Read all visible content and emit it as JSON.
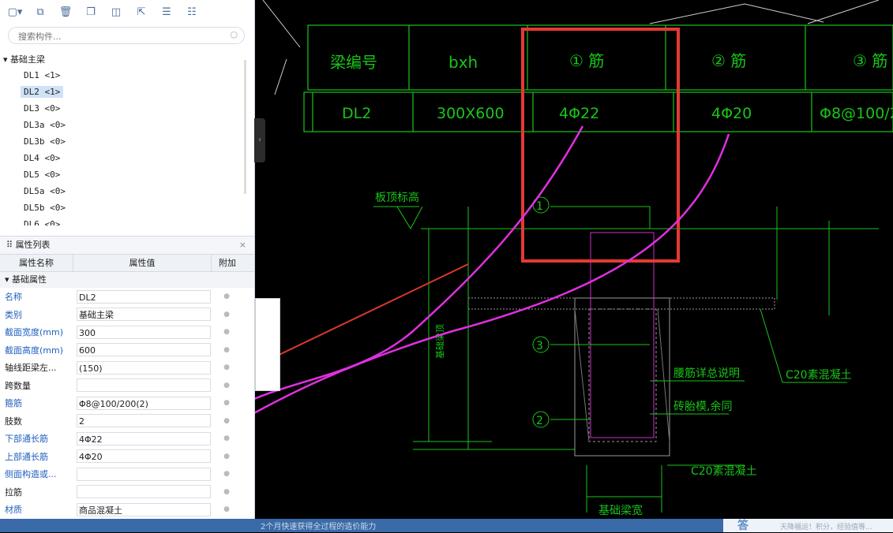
{
  "toolbar": {
    "icons": [
      "new-icon",
      "copy-icon",
      "delete-icon",
      "duplicate-icon",
      "layer-icon",
      "export-icon",
      "list-icon",
      "settings-icon"
    ]
  },
  "search": {
    "placeholder": "搜索构件..."
  },
  "tree": {
    "root": "基础主梁",
    "items": [
      "DL1 <1>",
      "DL2 <1>",
      "DL3 <0>",
      "DL3a <0>",
      "DL3b <0>",
      "DL4 <0>",
      "DL5 <0>",
      "DL5a <0>",
      "DL5b <0>",
      "DL6 <0>"
    ],
    "selected": "DL2 <1>"
  },
  "props": {
    "title": "属性列表",
    "close": "×",
    "col_name": "属性名称",
    "col_value": "属性值",
    "col_extra": "附加",
    "group": "基础属性",
    "rows": [
      {
        "name": "名称",
        "value": "DL2"
      },
      {
        "name": "类别",
        "value": "基础主梁"
      },
      {
        "name": "截面宽度(mm)",
        "value": "300"
      },
      {
        "name": "截面高度(mm)",
        "value": "600"
      },
      {
        "name": "轴线距梁左...",
        "value": "(150)"
      },
      {
        "name": "跨数量",
        "value": ""
      },
      {
        "name": "箍筋",
        "value": "Φ8@100/200(2)"
      },
      {
        "name": "肢数",
        "value": "2"
      },
      {
        "name": "下部通长筋",
        "value": "4Φ22"
      },
      {
        "name": "上部通长筋",
        "value": "4Φ20"
      },
      {
        "name": "侧面构造或...",
        "value": ""
      },
      {
        "name": "拉筋",
        "value": ""
      },
      {
        "name": "材质",
        "value": "商品混凝土"
      }
    ]
  },
  "cad": {
    "headers": [
      "梁编号",
      "bxh",
      "① 筋",
      "② 筋",
      "③ 筋"
    ],
    "row": [
      "DL2",
      "300X600",
      "4Φ22",
      "4Φ20",
      "Φ8@100/2"
    ],
    "labels": {
      "slab_top": "板顶标高",
      "beam_top": "基础梁顶",
      "waist": "腰筋详总说明",
      "brick": "砖胎模,余同",
      "c20_right": "C20素混凝土",
      "c20_bottom": "C20素混凝土",
      "beam_width": "基础梁宽",
      "mark1": "1",
      "mark2": "2",
      "mark3": "3"
    }
  },
  "bottom": {
    "text": "2个月快速获得全过程的造价能力",
    "ad_q": "答",
    "ad_text": "天降福运！积分，经验值等..."
  },
  "colors": {
    "cad_line": "#19c419",
    "highlight": "#e53935",
    "annotation": "#e030e0",
    "arrow": "#d93a2a"
  }
}
